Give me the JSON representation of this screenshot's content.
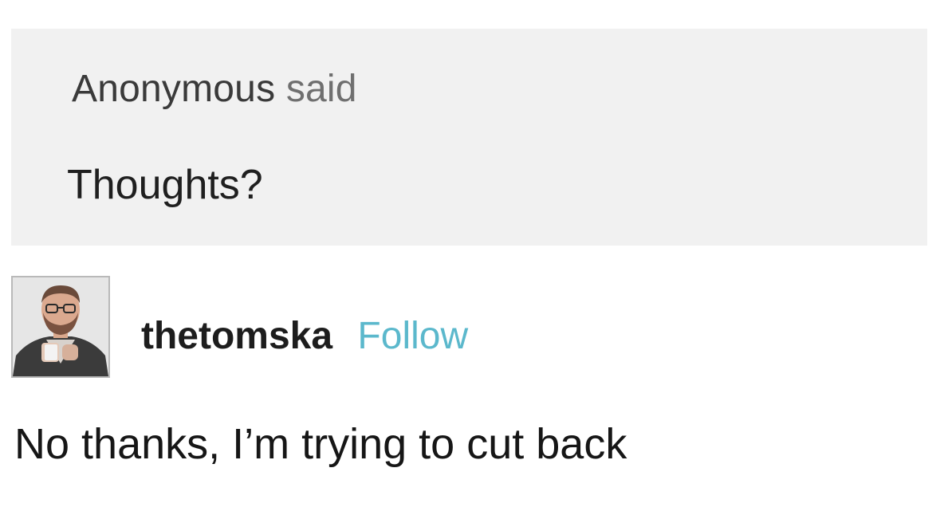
{
  "ask": {
    "asker": "Anonymous",
    "verb": "said",
    "question": "Thoughts?"
  },
  "answer": {
    "blog_name": "thetomska",
    "follow_label": "Follow",
    "avatar_icon": "user-avatar-photo",
    "text": "No thanks, I’m trying to cut back"
  },
  "colors": {
    "ask_background": "#f1f1f1",
    "follow_link": "#5bb8cc",
    "text": "#1f1f1f"
  }
}
